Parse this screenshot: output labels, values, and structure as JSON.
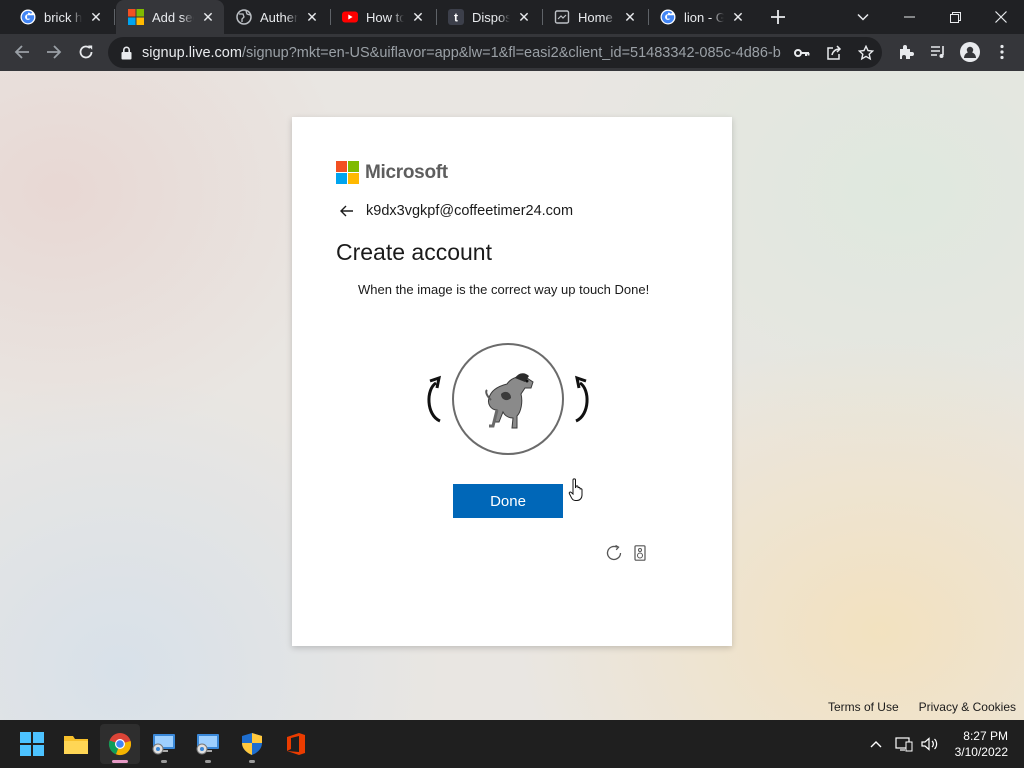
{
  "browser": {
    "tabs": [
      {
        "title": "brick he",
        "icon": "google-icon"
      },
      {
        "title": "Add sec",
        "icon": "microsoft-icon",
        "active": true
      },
      {
        "title": "Authent",
        "icon": "globe-icon"
      },
      {
        "title": "How to",
        "icon": "youtube-icon"
      },
      {
        "title": "Disposa",
        "icon": "tumblr-icon"
      },
      {
        "title": "Home -",
        "icon": "page-icon"
      },
      {
        "title": "lion - G",
        "icon": "google-icon"
      }
    ],
    "url_host": "signup.live.com",
    "url_rest": "/signup?mkt=en-US&uiflavor=app&lw=1&fl=easi2&client_id=51483342-085c-4d86-b..."
  },
  "signup": {
    "brand": "Microsoft",
    "email": "k9dx3vgkpf@coffeetimer24.com",
    "heading": "Create account",
    "instruction": "When the image is the correct way up touch Done!",
    "done_label": "Done"
  },
  "footer": {
    "terms": "Terms of Use",
    "privacy": "Privacy & Cookies"
  },
  "taskbar": {
    "apps": [
      "start-icon",
      "file-explorer-icon",
      "chrome-icon",
      "remote-desktop-icon",
      "remote-desktop-icon",
      "windows-security-icon",
      "office-icon"
    ],
    "time": "8:27 PM",
    "date": "3/10/2022"
  },
  "colors": {
    "accent": "#0067b8",
    "ms_red": "#f25022",
    "ms_green": "#7fba00",
    "ms_blue": "#00a4ef",
    "ms_yellow": "#ffb900"
  }
}
